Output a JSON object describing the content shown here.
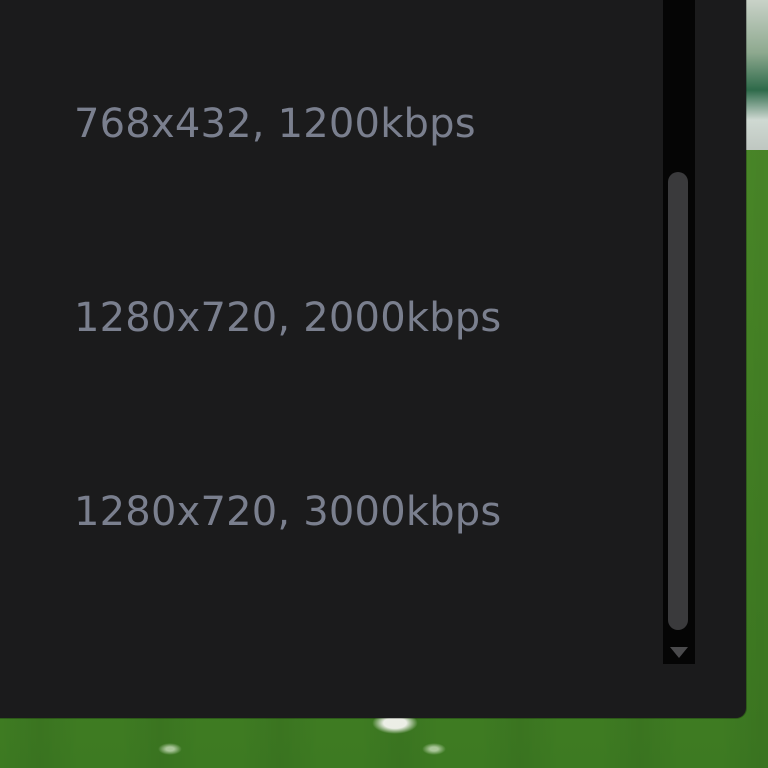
{
  "quality_menu": {
    "items": [
      {
        "label": "768x432, 1200kbps"
      },
      {
        "label": "1280x720, 2000kbps"
      },
      {
        "label": "1280x720, 3000kbps"
      }
    ]
  },
  "colors": {
    "menu_background": "#1b1b1c",
    "menu_text": "#7a7f8e",
    "scrollbar_track": "#050505",
    "scrollbar_thumb": "#3a3a3c",
    "video_pitch": "#478626"
  },
  "icons": {
    "scroll_down": "triangle-down"
  }
}
